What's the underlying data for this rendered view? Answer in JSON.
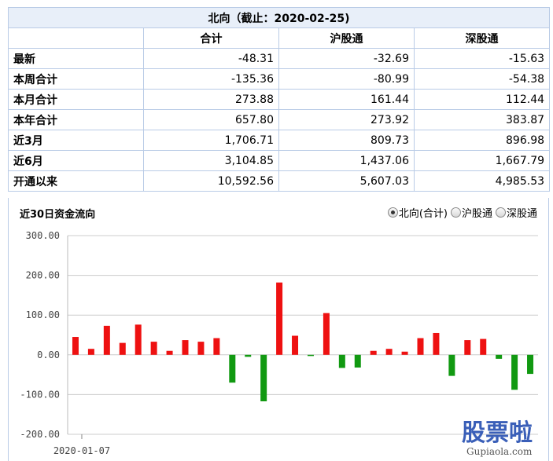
{
  "table": {
    "caption": "北向（截止：2020-02-25)",
    "columns": [
      "",
      "合计",
      "沪股通",
      "深股通"
    ],
    "rows": [
      {
        "label": "最新",
        "values": [
          "-48.31",
          "-32.69",
          "-15.63"
        ]
      },
      {
        "label": "本周合计",
        "values": [
          "-135.36",
          "-80.99",
          "-54.38"
        ]
      },
      {
        "label": "本月合计",
        "values": [
          "273.88",
          "161.44",
          "112.44"
        ]
      },
      {
        "label": "本年合计",
        "values": [
          "657.80",
          "273.92",
          "383.87"
        ]
      },
      {
        "label": "近3月",
        "values": [
          "1,706.71",
          "809.73",
          "896.98"
        ]
      },
      {
        "label": "近6月",
        "values": [
          "3,104.85",
          "1,437.06",
          "1,667.79"
        ]
      },
      {
        "label": "开通以来",
        "values": [
          "10,592.56",
          "5,607.03",
          "4,985.53"
        ]
      }
    ]
  },
  "chart_section": {
    "title": "近30日资金流向",
    "radio_options": [
      {
        "label": "北向(合计)",
        "selected": true
      },
      {
        "label": "沪股通",
        "selected": false
      },
      {
        "label": "深股通",
        "selected": false
      }
    ]
  },
  "chart_data": {
    "type": "bar",
    "x": [
      "2020-01-07"
    ],
    "series": [
      {
        "values": [
          45,
          15,
          73,
          30,
          76,
          33,
          10,
          37,
          33,
          42,
          -70,
          -5,
          -117,
          182,
          48,
          -3,
          105,
          -33,
          -32,
          10,
          15,
          8,
          42,
          55,
          -53,
          37,
          40,
          -10,
          -88,
          -48
        ]
      }
    ],
    "ylim": [
      -200,
      300
    ],
    "yticks": [
      "300.00",
      "200.00",
      "100.00",
      "0.00",
      "-100.00",
      "-200.00"
    ],
    "ytick_values": [
      300,
      200,
      100,
      0,
      -100,
      -200
    ],
    "xtick_label": "2020-01-07",
    "colors": {
      "positive": "#ee1111",
      "negative": "#119911",
      "grid": "#cccccc"
    },
    "grid": true
  },
  "watermark": {
    "text_big": "股票啦",
    "text_small": "Gupiaola.com"
  }
}
